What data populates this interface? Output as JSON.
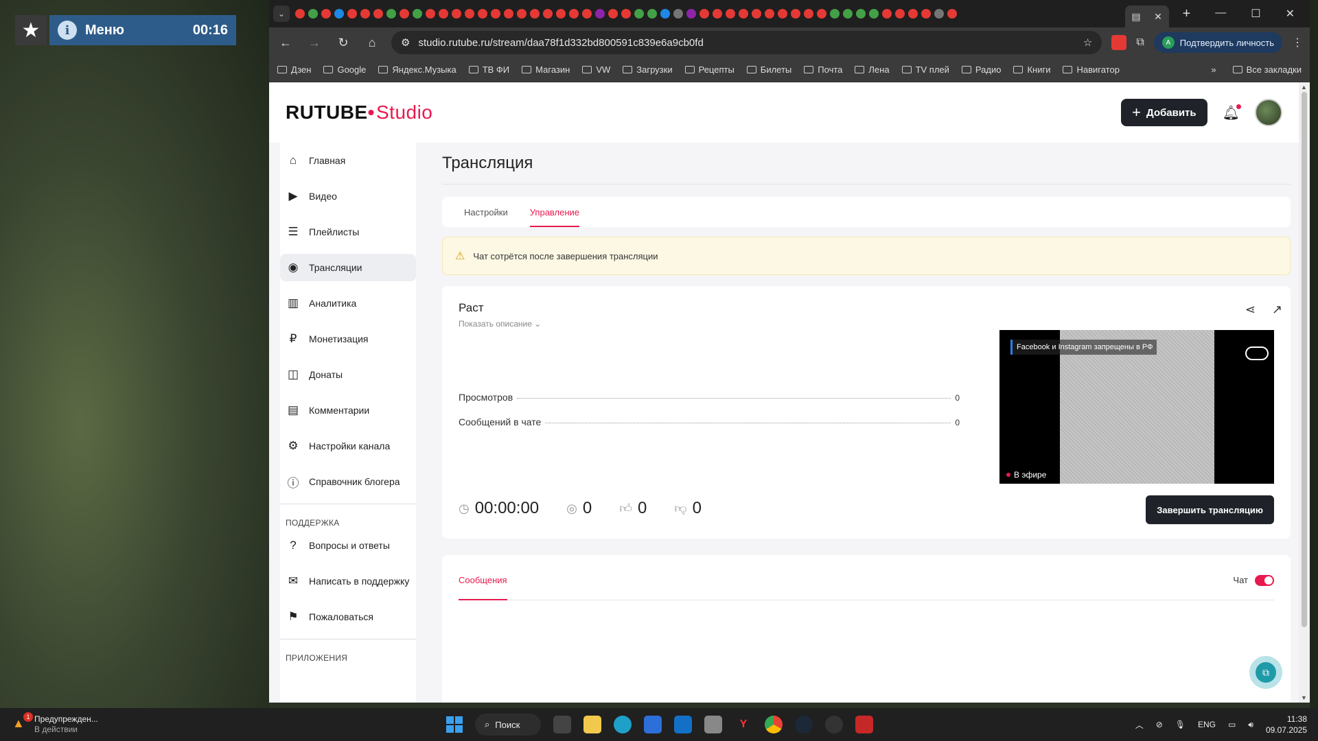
{
  "overlay": {
    "menu_label": "Меню",
    "timer": "00:16"
  },
  "browser": {
    "url": "studio.rutube.ru/stream/daa78f1d332bd800591c839e6a9cb0fd",
    "verify_label": "Подтвердить личность",
    "bookmarks": [
      "Дзен",
      "Google",
      "Яндекс.Музыка",
      "ТВ ФИ",
      "Магазин",
      "VW",
      "Загрузки",
      "Рецепты",
      "Билеты",
      "Почта",
      "Лена",
      "TV плей",
      "Радио",
      "Книги",
      "Навигатор"
    ],
    "all_bookmarks": "Все закладки",
    "tab_colors": [
      "#e53935",
      "#43a047",
      "#e53935",
      "#1e88e5",
      "#e53935",
      "#e53935",
      "#e53935",
      "#43a047",
      "#e53935",
      "#43a047",
      "#e53935",
      "#e53935",
      "#e53935",
      "#e53935",
      "#e53935",
      "#e53935",
      "#e53935",
      "#e53935",
      "#e53935",
      "#e53935",
      "#e53935",
      "#e53935",
      "#e53935",
      "#8e24aa",
      "#e53935",
      "#e53935",
      "#43a047",
      "#43a047",
      "#1e88e5",
      "#757575",
      "#8e24aa",
      "#e53935",
      "#e53935",
      "#e53935",
      "#e53935",
      "#e53935",
      "#e53935",
      "#e53935",
      "#e53935",
      "#e53935",
      "#e53935",
      "#43a047",
      "#43a047",
      "#43a047",
      "#43a047",
      "#e53935",
      "#e53935",
      "#e53935",
      "#e53935",
      "#757575",
      "#e53935"
    ]
  },
  "studio": {
    "logo_main": "RUTUBE",
    "logo_studio": "Studio",
    "add_button": "Добавить",
    "nav": [
      {
        "label": "Главная",
        "icon": "home-icon",
        "glyph": "⌂"
      },
      {
        "label": "Видео",
        "icon": "video-icon",
        "glyph": "▶"
      },
      {
        "label": "Плейлисты",
        "icon": "playlist-icon",
        "glyph": "☰"
      },
      {
        "label": "Трансляции",
        "icon": "broadcast-icon",
        "glyph": "◉"
      },
      {
        "label": "Аналитика",
        "icon": "analytics-icon",
        "glyph": "▥"
      },
      {
        "label": "Монетизация",
        "icon": "monetization-icon",
        "glyph": "₽"
      },
      {
        "label": "Донаты",
        "icon": "donate-icon",
        "glyph": "◫"
      },
      {
        "label": "Комментарии",
        "icon": "comments-icon",
        "glyph": "▤"
      },
      {
        "label": "Настройки канала",
        "icon": "settings-icon",
        "glyph": "⚙"
      },
      {
        "label": "Справочник блогера",
        "icon": "info-icon",
        "glyph": "ⓘ"
      }
    ],
    "support_label": "ПОДДЕРЖКА",
    "support_nav": [
      {
        "label": "Вопросы и ответы",
        "icon": "help-icon",
        "glyph": "?"
      },
      {
        "label": "Написать в поддержку",
        "icon": "mail-icon",
        "glyph": "✉"
      },
      {
        "label": "Пожаловаться",
        "icon": "flag-icon",
        "glyph": "⚑"
      }
    ],
    "apps_label": "ПРИЛОЖЕНИЯ"
  },
  "main": {
    "title": "Трансляция",
    "tabs": [
      "Настройки",
      "Управление"
    ],
    "warning": "Чат сотрётся после завершения трансляции",
    "stream_title": "Раст",
    "show_description": "Показать описание",
    "stats": [
      {
        "label": "Просмотров",
        "value": "0"
      },
      {
        "label": "Сообщений в чате",
        "value": "0"
      }
    ],
    "duration": "00:00:00",
    "viewers": "0",
    "likes": "0",
    "dislikes": "0",
    "preview_notice": "Facebook и Instagram запрещены в РФ",
    "live_label": "В эфире",
    "end_button": "Завершить трансляцию",
    "chat_tab": "Сообщения",
    "chat_toggle_label": "Чат"
  },
  "taskbar": {
    "warning_title": "Предупрежден...",
    "warning_sub": "В действии",
    "warning_count": "1",
    "search_label": "Поиск",
    "lang": "ENG",
    "time": "11:38",
    "date": "09.07.2025"
  }
}
